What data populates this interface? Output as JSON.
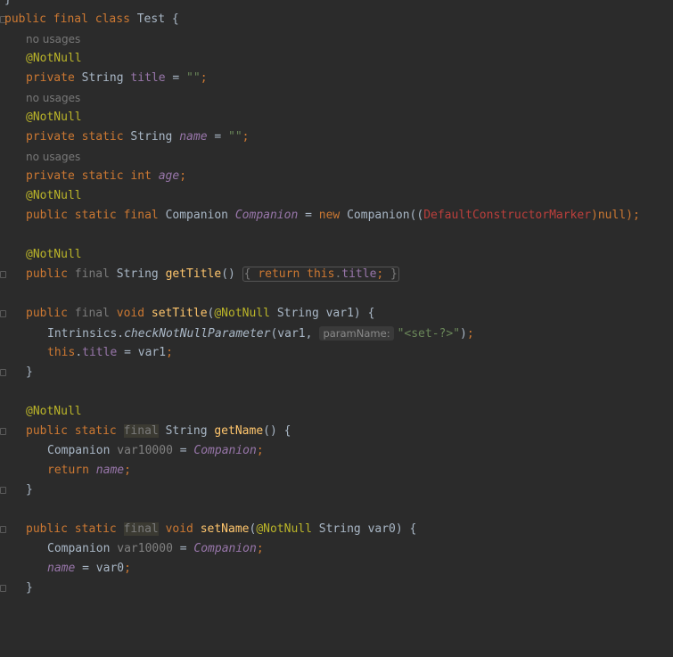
{
  "editor": {
    "lines": {
      "l0_brace": "}",
      "l1_public": "public",
      "l1_final": "final",
      "l1_class": "class",
      "l1_name": "Test {",
      "hint_no_usages": "no usages",
      "ann_notnull": "@NotNull",
      "kw_private": "private",
      "kw_public": "public",
      "kw_static": "static",
      "kw_final": "final",
      "kw_int": "int",
      "kw_new": "new",
      "kw_return": "return",
      "kw_this": "this",
      "kw_void": "void",
      "type_string": "String",
      "type_companion": "Companion",
      "f_title": "title",
      "f_name": "name",
      "f_age": "age",
      "f_companion": "Companion",
      "str_empty": "\"\"",
      "semi": ";",
      "eq": "=",
      "companion_init_open": "Companion((",
      "default_marker": "DefaultConstructorMarker",
      "companion_init_close": ")null);",
      "m_getTitle": "getTitle",
      "m_setTitle": "setTitle",
      "m_getName": "getName",
      "m_setName": "setName",
      "intrinsics": "Intrinsics.",
      "checkNotNull": "checkNotNullParameter",
      "param_name_hint": "paramName:",
      "set_str": "\"<set-?>\"",
      "var1": "var1",
      "var0": "var0",
      "var10000": "var10000",
      "close_brace": "}"
    }
  }
}
